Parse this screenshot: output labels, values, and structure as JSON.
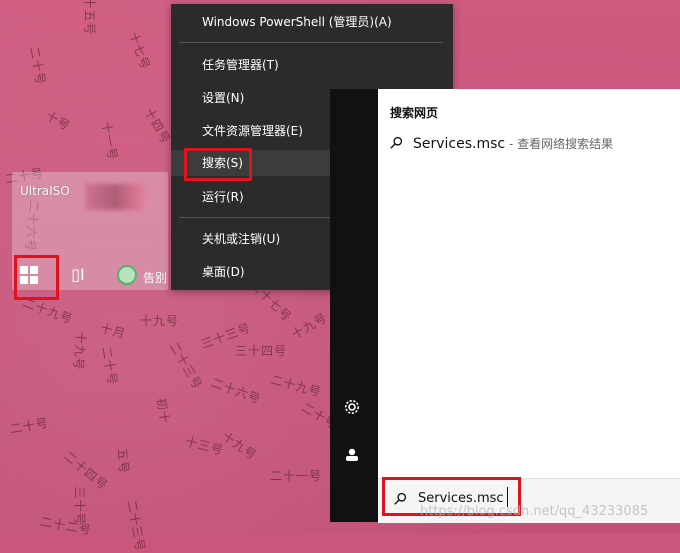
{
  "wallpaper": {
    "labels": [
      "十五号",
      "二十号",
      "十七号",
      "十号",
      "十一号",
      "十四号",
      "二十号",
      "二十六号",
      "二十九号",
      "十九号",
      "十月",
      "十九号",
      "二十号",
      "二十三号",
      "三十三号",
      "三十四号",
      "二十六号",
      "二十七号",
      "十九号",
      "二十九号",
      "初十",
      "十三号",
      "五号",
      "二十号",
      "二十四号",
      "十九号",
      "二十三号",
      "二十号",
      "二十一号",
      "二十二号",
      "三十号"
    ]
  },
  "taskbar": {
    "app1_label": "UltraISO",
    "app2_label": "告别"
  },
  "context_menu": {
    "items": [
      {
        "label": "Windows PowerShell (管理员)(A)"
      },
      {
        "label": "任务管理器(T)"
      },
      {
        "label": "设置(N)"
      },
      {
        "label": "文件资源管理器(E)"
      },
      {
        "label": "搜索(S)"
      },
      {
        "label": "运行(R)"
      },
      {
        "label": "关机或注销(U)"
      },
      {
        "label": "桌面(D)"
      }
    ]
  },
  "start_panel": {
    "title": "搜索网页",
    "result_main": "Services.msc",
    "result_sub": " - 查看网络搜索结果",
    "search_value": "Services.msc"
  },
  "watermark": "https://blog.csdn.net/qq_43233085",
  "colors": {
    "menu_bg": "#2b2b2b",
    "highlight": "#e0121e",
    "wallpaper": "#c9577b"
  }
}
